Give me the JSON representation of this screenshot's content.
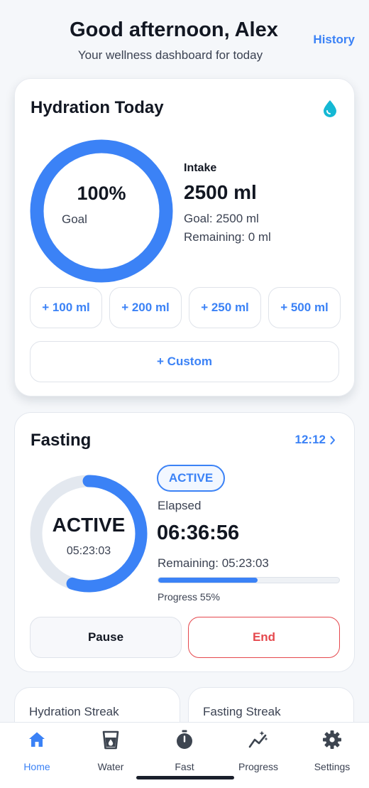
{
  "header": {
    "greeting": "Good afternoon, Alex",
    "subtitle": "Your wellness dashboard for today",
    "history_label": "History"
  },
  "hydration": {
    "title": "Hydration Today",
    "icon": "water-drop-icon",
    "ring_percent_text": "100%",
    "ring_label": "Goal",
    "progress_fraction": 1.0,
    "intake_label": "Intake",
    "intake_value": "2500 ml",
    "goal_text": "Goal: 2500 ml",
    "remaining_text": "Remaining: 0 ml",
    "quick_add": [
      "+ 100 ml",
      "+ 200 ml",
      "+ 250 ml",
      "+ 500 ml"
    ],
    "custom_label": "+ Custom"
  },
  "fasting": {
    "title": "Fasting",
    "schedule_label": "12:12",
    "ring_title": "ACTIVE",
    "ring_time": "05:23:03",
    "status_badge": "ACTIVE",
    "elapsed_label": "Elapsed",
    "elapsed_value": "06:36:56",
    "remaining_text": "Remaining: 05:23:03",
    "progress_fraction": 0.55,
    "progress_text": "Progress 55%",
    "pause_label": "Pause",
    "end_label": "End"
  },
  "streaks": [
    {
      "label": "Hydration Streak"
    },
    {
      "label": "Fasting Streak"
    }
  ],
  "nav": {
    "items": [
      {
        "label": "Home",
        "icon": "home-icon",
        "active": true
      },
      {
        "label": "Water",
        "icon": "water-glass-icon",
        "active": false
      },
      {
        "label": "Fast",
        "icon": "stopwatch-icon",
        "active": false
      },
      {
        "label": "Progress",
        "icon": "progress-chart-icon",
        "active": false
      },
      {
        "label": "Settings",
        "icon": "gear-icon",
        "active": false
      }
    ]
  },
  "colors": {
    "accent": "#3b82f6",
    "danger": "#e5484d",
    "drop": "#14b8d4",
    "text": "#121722",
    "muted": "#3b4252",
    "nav_icon": "#3d4550"
  }
}
